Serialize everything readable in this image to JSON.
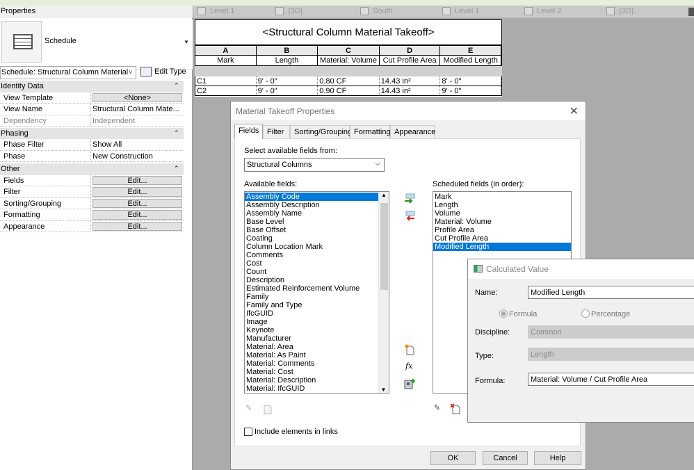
{
  "view_tabs": [
    {
      "label": "Level 1",
      "icon": "floor-plan-icon"
    },
    {
      "label": "{3D}",
      "icon": "3d-view-icon"
    },
    {
      "label": "South",
      "icon": "elevation-icon"
    },
    {
      "label": "Level 1",
      "icon": "ceiling-plan-icon"
    },
    {
      "label": "Level 2",
      "icon": "floor-plan-icon"
    },
    {
      "label": "{3D}",
      "icon": "3d-view-icon"
    }
  ],
  "properties": {
    "title": "Properties",
    "type_name": "Schedule",
    "selector": "Schedule: Structural Column Material",
    "edit_type": "Edit Type",
    "rows": [
      {
        "kind": "group",
        "label": "Identity Data"
      },
      {
        "kind": "button",
        "label": "View Template",
        "value": "<None>"
      },
      {
        "kind": "text",
        "label": "View Name",
        "value": "Structural Column Mate..."
      },
      {
        "kind": "disabled",
        "label": "Dependency",
        "value": "Independent"
      },
      {
        "kind": "group",
        "label": "Phasing"
      },
      {
        "kind": "text",
        "label": "Phase Filter",
        "value": "Show All"
      },
      {
        "kind": "text",
        "label": "Phase",
        "value": "New Construction"
      },
      {
        "kind": "group",
        "label": "Other"
      },
      {
        "kind": "button",
        "label": "Fields",
        "value": "Edit..."
      },
      {
        "kind": "button",
        "label": "Filter",
        "value": "Edit..."
      },
      {
        "kind": "button",
        "label": "Sorting/Grouping",
        "value": "Edit..."
      },
      {
        "kind": "button",
        "label": "Formatting",
        "value": "Edit..."
      },
      {
        "kind": "button",
        "label": "Appearance",
        "value": "Edit..."
      }
    ]
  },
  "schedule": {
    "title": "<Structural Column Material Takeoff>",
    "letters": [
      "A",
      "B",
      "C",
      "D",
      "E"
    ],
    "headers": [
      "Mark",
      "Length",
      "Material: Volume",
      "Cut Profile Area",
      "Modified Length"
    ],
    "rows": [
      [
        "C1",
        "9' - 0\"",
        "0.80 CF",
        "14.43 in²",
        "8' - 0\""
      ],
      [
        "C2",
        "9' - 0\"",
        "0.90 CF",
        "14.43 in²",
        "9' - 0\""
      ]
    ]
  },
  "material_dialog": {
    "title": "Material Takeoff Properties",
    "tabs": [
      "Fields",
      "Filter",
      "Sorting/Grouping",
      "Formatting",
      "Appearance"
    ],
    "active_tab": "Fields",
    "select_from_label": "Select available fields from:",
    "select_from_value": "Structural Columns",
    "available_label": "Available fields:",
    "available": [
      "Assembly Code",
      "Assembly Description",
      "Assembly Name",
      "Base Level",
      "Base Offset",
      "Coating",
      "Column Location Mark",
      "Comments",
      "Cost",
      "Count",
      "Description",
      "Estimated Reinforcement Volume",
      "Family",
      "Family and Type",
      "IfcGUID",
      "Image",
      "Keynote",
      "Manufacturer",
      "Material: Area",
      "Material: As Paint",
      "Material: Comments",
      "Material: Cost",
      "Material: Description",
      "Material: IfcGUID"
    ],
    "available_selected": "Assembly Code",
    "scheduled_label": "Scheduled fields (in order):",
    "scheduled": [
      "Mark",
      "Length",
      "Volume",
      "Material: Volume",
      "Profile Area",
      "Cut Profile Area",
      "Modified Length"
    ],
    "scheduled_selected": "Modified Length",
    "include_links": "Include elements in links",
    "include_links_checked": false,
    "ok": "OK",
    "cancel": "Cancel",
    "help": "Help"
  },
  "calc_dialog": {
    "title": "Calculated Value",
    "name_label": "Name:",
    "name_value": "Modified Length",
    "formula_radio": "Formula",
    "percentage_radio": "Percentage",
    "selected_mode": "Formula",
    "discipline_label": "Discipline:",
    "discipline_value": "Common",
    "type_label": "Type:",
    "type_value": "Length",
    "formula_label": "Formula:",
    "formula_value": "Material: Volume / Cut Profile Area"
  }
}
